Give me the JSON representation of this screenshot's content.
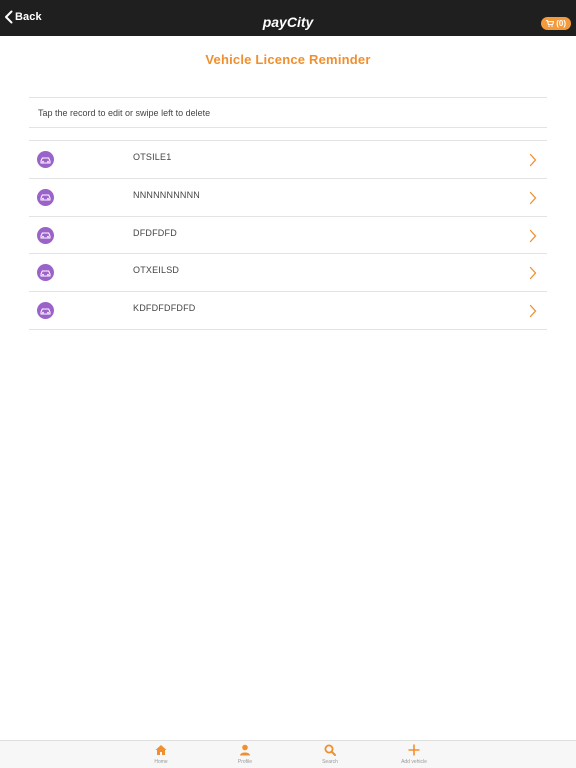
{
  "header": {
    "back_label": "Back",
    "app_title": "payCity",
    "cart_count": "(0)"
  },
  "main": {
    "title": "Vehicle Licence Reminder",
    "instruction": "Tap the record to edit or swipe left to delete",
    "records": [
      {
        "label": "OTSILE1",
        "icon": "car-icon"
      },
      {
        "label": "NNNNNNNNNN",
        "icon": "car-icon"
      },
      {
        "label": "DFDFDFD",
        "icon": "car-icon"
      },
      {
        "label": "OTXEILSD",
        "icon": "car-icon"
      },
      {
        "label": "KDFDFDFDFD",
        "icon": "car-icon"
      }
    ]
  },
  "tabbar": {
    "tabs": [
      {
        "label": "Home",
        "icon": "home-icon"
      },
      {
        "label": "Profile",
        "icon": "profile-icon"
      },
      {
        "label": "Search",
        "icon": "search-icon"
      },
      {
        "label": "Add vehicle",
        "icon": "plus-icon"
      }
    ]
  },
  "colors": {
    "accent": "#f08f2f",
    "header_bg": "#1f1f1f",
    "icon_bg": "#9b62c9",
    "cart_bg": "#f59a3b"
  }
}
